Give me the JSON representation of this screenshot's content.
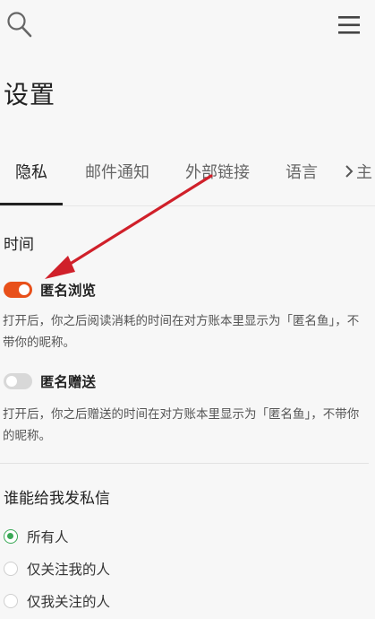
{
  "header": {
    "search_icon": "search-icon",
    "menu_icon": "hamburger-menu-icon"
  },
  "page": {
    "title": "设置"
  },
  "tabs": {
    "items": [
      {
        "label": "隐私",
        "active": true
      },
      {
        "label": "邮件通知",
        "active": false
      },
      {
        "label": "外部链接",
        "active": false
      },
      {
        "label": "语言",
        "active": false
      }
    ],
    "overflow_label": "主",
    "chevron_icon": "chevron-right-icon"
  },
  "time_section": {
    "title": "时间",
    "anonymous_browse": {
      "label": "匿名浏览",
      "enabled": true,
      "description": "打开后，你之后阅读消耗的时间在对方账本里显示为「匿名鱼」，不带你的昵称。"
    },
    "anonymous_gift": {
      "label": "匿名赠送",
      "enabled": false,
      "description": "打开后，你之后赠送的时间在对方账本里显示为「匿名鱼」，不带你的昵称。"
    }
  },
  "message_section": {
    "title": "谁能给我发私信",
    "options": [
      {
        "label": "所有人",
        "checked": true
      },
      {
        "label": "仅关注我的人",
        "checked": false
      },
      {
        "label": "仅我关注的人",
        "checked": false
      }
    ]
  },
  "colors": {
    "accent_toggle_on": "#e8501a",
    "toggle_off": "#d8d8d8",
    "radio_checked": "#3aa856",
    "annotation_arrow": "#d0202a",
    "background": "#f7f7f7"
  }
}
